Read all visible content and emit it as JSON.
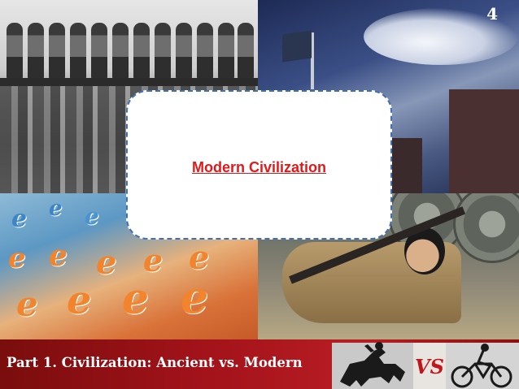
{
  "slide": {
    "page_number": "4",
    "title": "Modern Civilization",
    "footer_text": "Part 1. Civilization: Ancient vs. Modern",
    "vs_label": "VS"
  },
  "images": {
    "top_left": "workers on steel beam above city",
    "top_right": "factory smokestack and flag",
    "bottom_left": "internet explorer logos",
    "bottom_right": "child soldier sleeping with rifle by tank"
  },
  "colors": {
    "title_red": "#e01a1a",
    "card_border_blue": "#3f6fb6",
    "footer_red": "#a3131a"
  }
}
